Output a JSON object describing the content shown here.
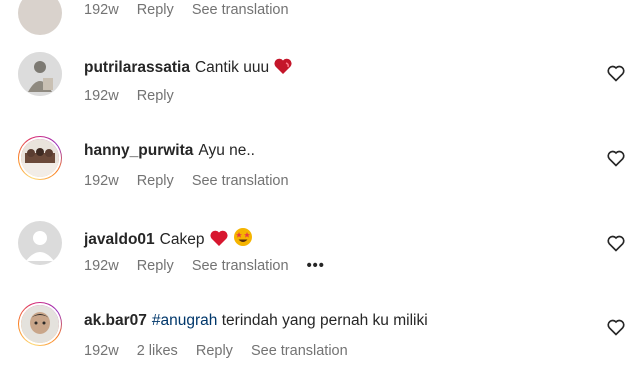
{
  "comments": [
    {
      "username": "",
      "text": "",
      "meta": {
        "time": "192w",
        "reply": "Reply",
        "translate": "See translation"
      }
    },
    {
      "username": "putrilarassatia",
      "text": "Cantik uuu",
      "emoji": "heart-emoji",
      "meta": {
        "time": "192w",
        "reply": "Reply"
      }
    },
    {
      "username": "hanny_purwita",
      "text": "Ayu ne..",
      "meta": {
        "time": "192w",
        "reply": "Reply",
        "translate": "See translation"
      }
    },
    {
      "username": "javaldo01",
      "text": "Cakep",
      "emoji": "heart-and-star-eyes-emoji",
      "meta": {
        "time": "192w",
        "reply": "Reply",
        "translate": "See translation",
        "more": "•••"
      }
    },
    {
      "username": "ak.bar07",
      "hashtag": "#anugrah",
      "text": "terindah yang pernah ku miliki",
      "meta": {
        "time": "192w",
        "likes": "2 likes",
        "reply": "Reply",
        "translate": "See translation"
      }
    }
  ],
  "colors": {
    "meta_gray": "#737373",
    "hashtag_blue": "#00376b",
    "like_heart": "#ed1c40"
  },
  "icons": {
    "like": "heart-outline-icon"
  }
}
